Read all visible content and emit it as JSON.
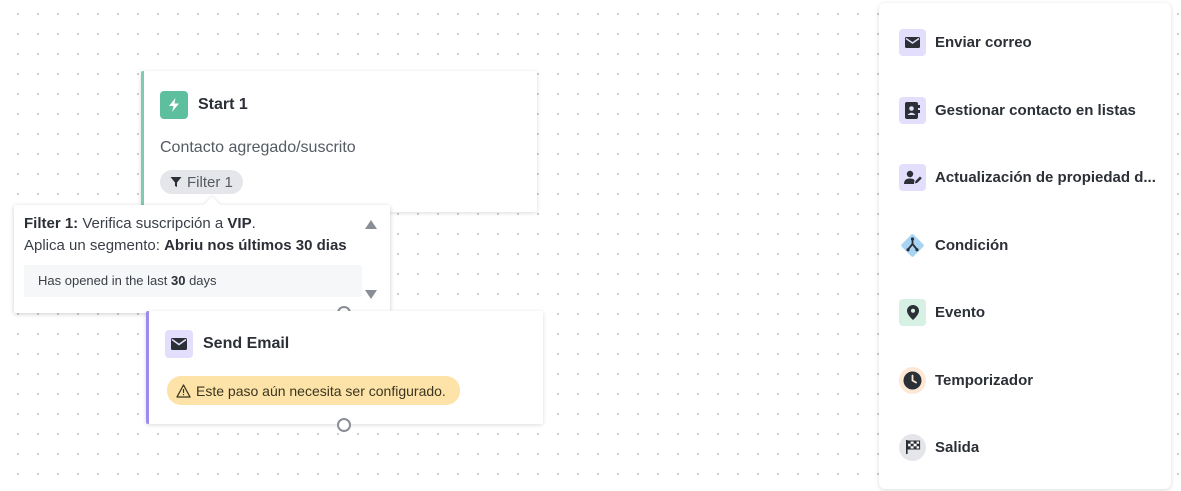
{
  "canvas": {
    "start_node": {
      "title": "Start 1",
      "subtitle": "Contacto agregado/suscrito",
      "filter_label": "Filter 1"
    },
    "tooltip": {
      "filter_name": "Filter 1:",
      "line1_text": " Verifica suscripción a ",
      "line1_value": "VIP",
      "line1_end": ".",
      "line2_text": "Aplica un segmento: ",
      "line2_value": "Abriu nos últimos 30 dias",
      "detail_text": "Has opened in the last ",
      "detail_value": "30",
      "detail_end": " days"
    },
    "send_node": {
      "title": "Send Email",
      "warning": "Este paso aún necesita ser configurado."
    }
  },
  "panel": {
    "items": [
      {
        "label": "Enviar correo",
        "icon": "envelope-icon"
      },
      {
        "label": "Gestionar contacto en listas",
        "icon": "contact-book-icon"
      },
      {
        "label": "Actualización de propiedad d...",
        "icon": "user-edit-icon"
      },
      {
        "label": "Condición",
        "icon": "branch-icon"
      },
      {
        "label": "Evento",
        "icon": "location-pin-icon"
      },
      {
        "label": "Temporizador",
        "icon": "clock-icon"
      },
      {
        "label": "Salida",
        "icon": "checkered-flag-icon"
      }
    ]
  },
  "colors": {
    "start_accent": "#7ecbb2",
    "send_accent": "#9c8cf0",
    "warning_bg": "#fde3a7"
  }
}
